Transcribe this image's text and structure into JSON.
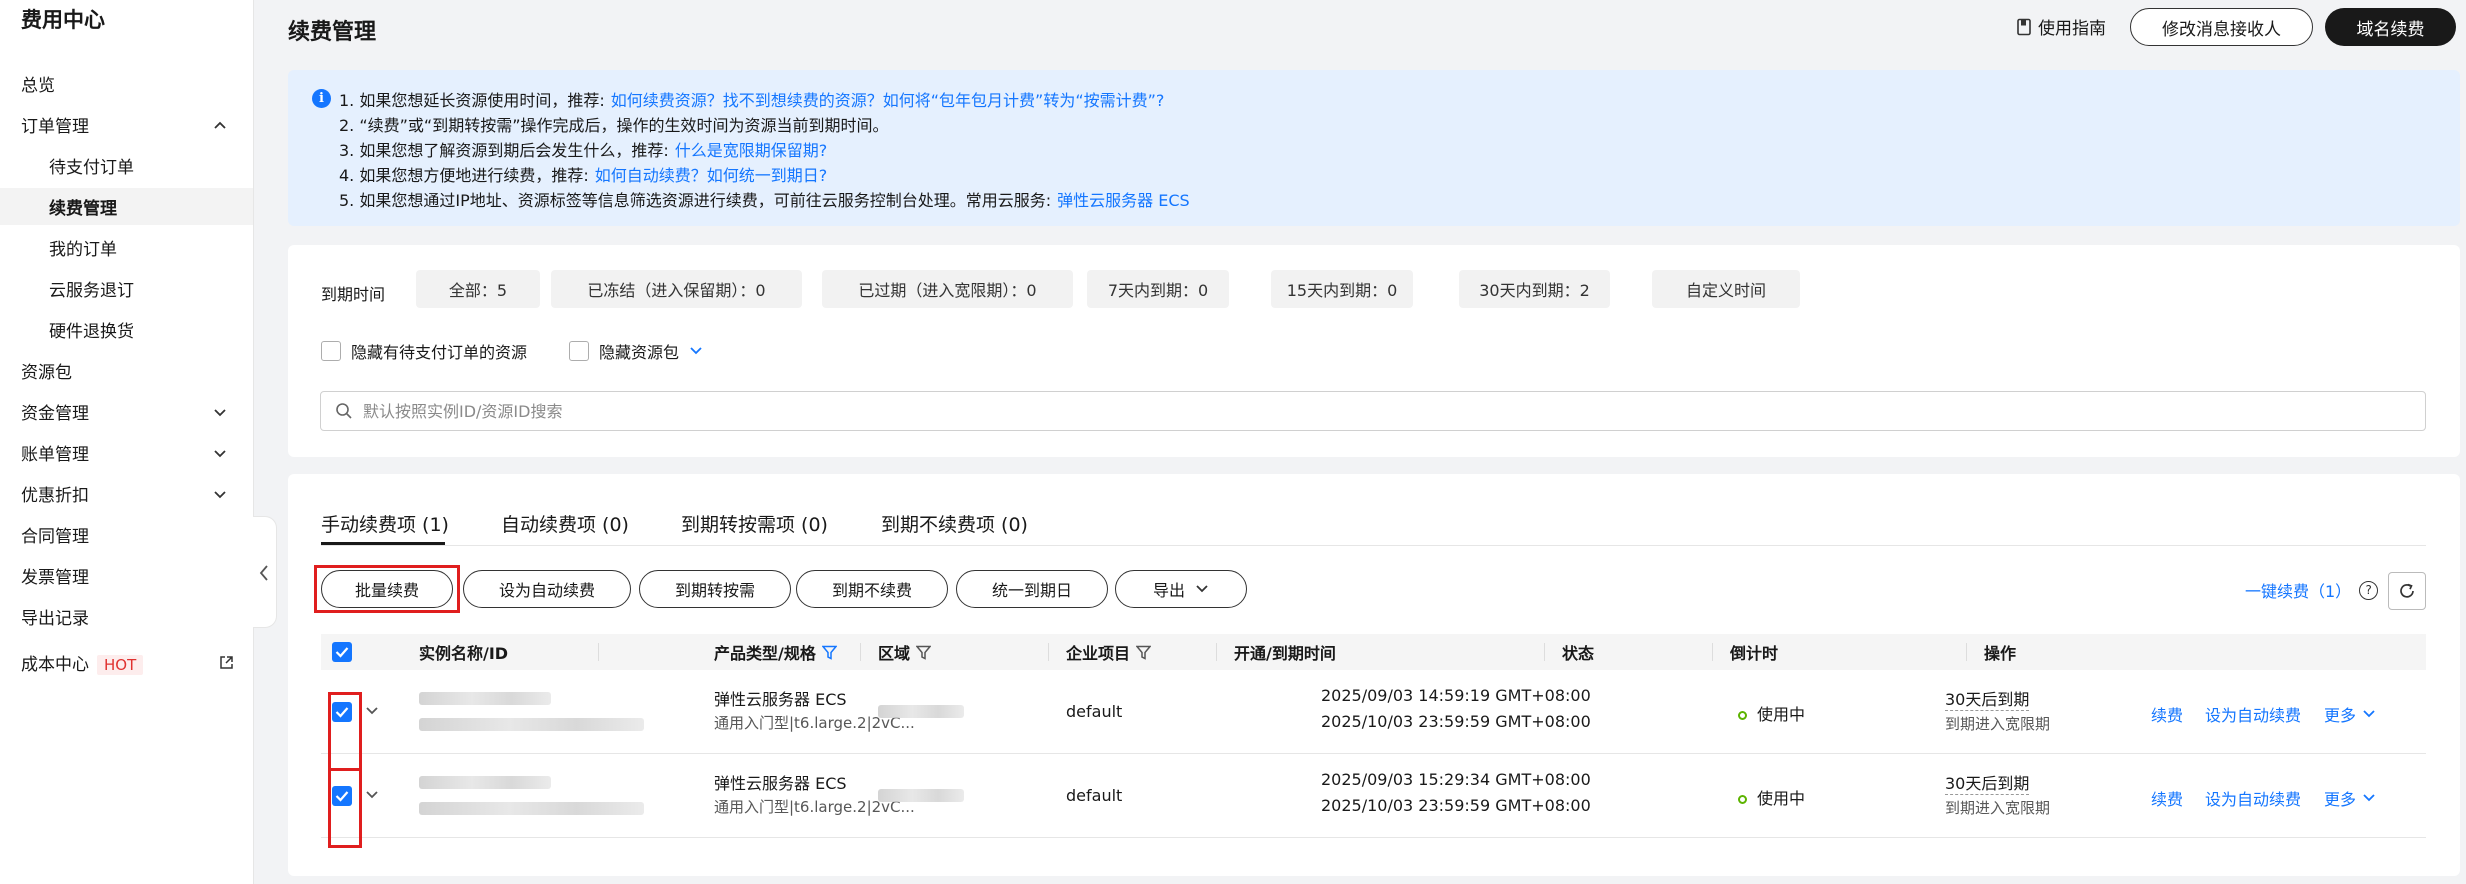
{
  "sidebar": {
    "title": "费用中心",
    "items": [
      {
        "label": "总览"
      },
      {
        "label": "订单管理"
      },
      {
        "label": "待支付订单"
      },
      {
        "label": "续费管理"
      },
      {
        "label": "我的订单"
      },
      {
        "label": "云服务退订"
      },
      {
        "label": "硬件退换货"
      },
      {
        "label": "资源包"
      },
      {
        "label": "资金管理"
      },
      {
        "label": "账单管理"
      },
      {
        "label": "优惠折扣"
      },
      {
        "label": "合同管理"
      },
      {
        "label": "发票管理"
      },
      {
        "label": "导出记录"
      },
      {
        "label": "成本中心"
      }
    ],
    "hot_badge": "HOT"
  },
  "header": {
    "title": "续费管理",
    "guide": "使用指南",
    "modify_receiver": "修改消息接收人",
    "domain_renew": "域名续费"
  },
  "notice": {
    "line1": "1. 如果您想延长资源使用时间，推荐:",
    "line1_link": "如何续费资源？找不到想续费的资源？如何将“包年包月计费”转为“按需计费”?",
    "line2": "2. “续费”或“到期转按需”操作完成后，操作的生效时间为资源当前到期时间。",
    "line3": "3. 如果您想了解资源到期后会发生什么，推荐:",
    "line3_link": "什么是宽限期保留期?",
    "line4": "4. 如果您想方便地进行续费，推荐:",
    "line4_link": "如何自动续费？如何统一到期日?",
    "line5": "5. 如果您想通过IP地址、资源标签等信息筛选资源进行续费，可前往云服务控制台处理。常用云服务:",
    "line5_link": "弹性云服务器 ECS"
  },
  "filter": {
    "label": "到期时间",
    "chips": [
      "全部：5",
      "已冻结（进入保留期）：0",
      "已过期（进入宽限期）：0",
      "7天内到期：0",
      "15天内到期：0",
      "30天内到期：2",
      "自定义时间"
    ],
    "hide_pending": "隐藏有待支付订单的资源",
    "hide_package": "隐藏资源包",
    "search_placeholder": "默认按照实例ID/资源ID搜索"
  },
  "tabs": [
    "手动续费项 (1)",
    "自动续费项 (0)",
    "到期转按需项 (0)",
    "到期不续费项 (0)"
  ],
  "actions": {
    "batch_renew": "批量续费",
    "set_auto": "设为自动续费",
    "to_ondemand": "到期转按需",
    "no_renew": "到期不续费",
    "unify_date": "统一到期日",
    "export": "导出",
    "one_key": "一键续费（1）"
  },
  "table": {
    "columns": [
      "实例名称/ID",
      "产品类型/规格",
      "区域",
      "企业项目",
      "开通/到期时间",
      "状态",
      "倒计时",
      "操作"
    ],
    "rows": [
      {
        "product": "弹性云服务器 ECS",
        "spec": "通用入门型|t6.large.2|2vC...",
        "project": "default",
        "open_time": "2025/09/03 14:59:19 GMT+08:00",
        "expire_time": "2025/10/03 23:59:59 GMT+08:00",
        "status": "使用中",
        "countdown": "30天后到期",
        "countdown_sub": "到期进入宽限期",
        "op_renew": "续费",
        "op_auto": "设为自动续费",
        "op_more": "更多"
      },
      {
        "product": "弹性云服务器 ECS",
        "spec": "通用入门型|t6.large.2|2vC...",
        "project": "default",
        "open_time": "2025/09/03 15:29:34 GMT+08:00",
        "expire_time": "2025/10/03 23:59:59 GMT+08:00",
        "status": "使用中",
        "countdown": "30天后到期",
        "countdown_sub": "到期进入宽限期",
        "op_renew": "续费",
        "op_auto": "设为自动续费",
        "op_more": "更多"
      }
    ]
  },
  "colors": {
    "accent": "#1476ff",
    "highlight": "#e01e1e",
    "status_ok": "#5cb300"
  }
}
